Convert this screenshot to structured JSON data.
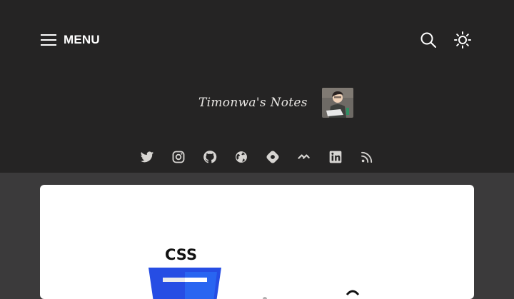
{
  "header": {
    "menu_label": "MENU",
    "menu_icon": "hamburger-icon",
    "search_icon": "search-icon",
    "theme_icon": "sun-icon",
    "brand_name": "Timonwa's Notes",
    "avatar_alt": "avatar"
  },
  "socials": [
    {
      "icon": "twitter-icon"
    },
    {
      "icon": "instagram-icon"
    },
    {
      "icon": "github-icon"
    },
    {
      "icon": "globe-icon"
    },
    {
      "icon": "hashnode-icon"
    },
    {
      "icon": "devto-icon"
    },
    {
      "icon": "linkedin-icon"
    },
    {
      "icon": "rss-icon"
    }
  ],
  "card": {
    "logo_text": "CSS",
    "logo_color": "#264de4"
  },
  "colors": {
    "header_bg": "#252424",
    "page_bg": "#3b3a3b",
    "icon": "#d7d5d2"
  }
}
